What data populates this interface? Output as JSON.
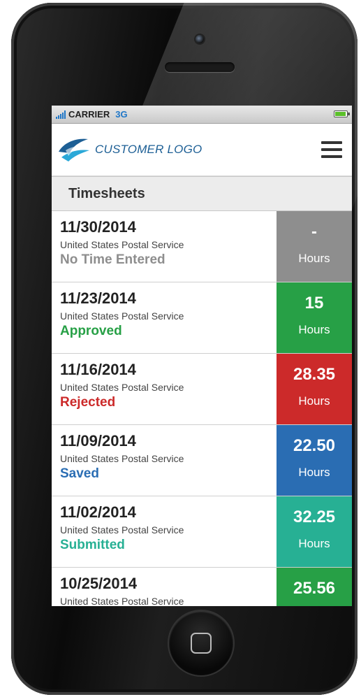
{
  "status_bar": {
    "carrier": "CARRIER",
    "network": "3G"
  },
  "header": {
    "logo_text": "CUSTOMER LOGO",
    "menu_icon": "hamburger-menu-icon"
  },
  "section": {
    "title": "Timesheets"
  },
  "colors": {
    "gray": "#8e8e8e",
    "approved": "#27a046",
    "rejected": "#cc2a2a",
    "saved": "#2a6db3",
    "submitted": "#27b094",
    "logo_blue": "#1d5f95"
  },
  "timesheets": [
    {
      "date": "11/30/2014",
      "company": "United States Postal Service",
      "status": "No Time Entered",
      "hours": "-",
      "unit": "Hours",
      "status_color": "#8e8e8e",
      "tile_color": "#8e8e8e"
    },
    {
      "date": "11/23/2014",
      "company": "United States Postal Service",
      "status": "Approved",
      "hours": "15",
      "unit": "Hours",
      "status_color": "#27a046",
      "tile_color": "#27a046"
    },
    {
      "date": "11/16/2014",
      "company": "United States Postal Service",
      "status": "Rejected",
      "hours": "28.35",
      "unit": "Hours",
      "status_color": "#cc2a2a",
      "tile_color": "#cc2a2a"
    },
    {
      "date": "11/09/2014",
      "company": "United States Postal Service",
      "status": "Saved",
      "hours": "22.50",
      "unit": "Hours",
      "status_color": "#2a6db3",
      "tile_color": "#2a6db3"
    },
    {
      "date": "11/02/2014",
      "company": "United States Postal Service",
      "status": "Submitted",
      "hours": "32.25",
      "unit": "Hours",
      "status_color": "#27b094",
      "tile_color": "#27b094"
    },
    {
      "date": "10/25/2014",
      "company": "United States Postal Service",
      "status": "",
      "hours": "25.56",
      "unit": "",
      "status_color": "#27a046",
      "tile_color": "#27a046"
    }
  ]
}
